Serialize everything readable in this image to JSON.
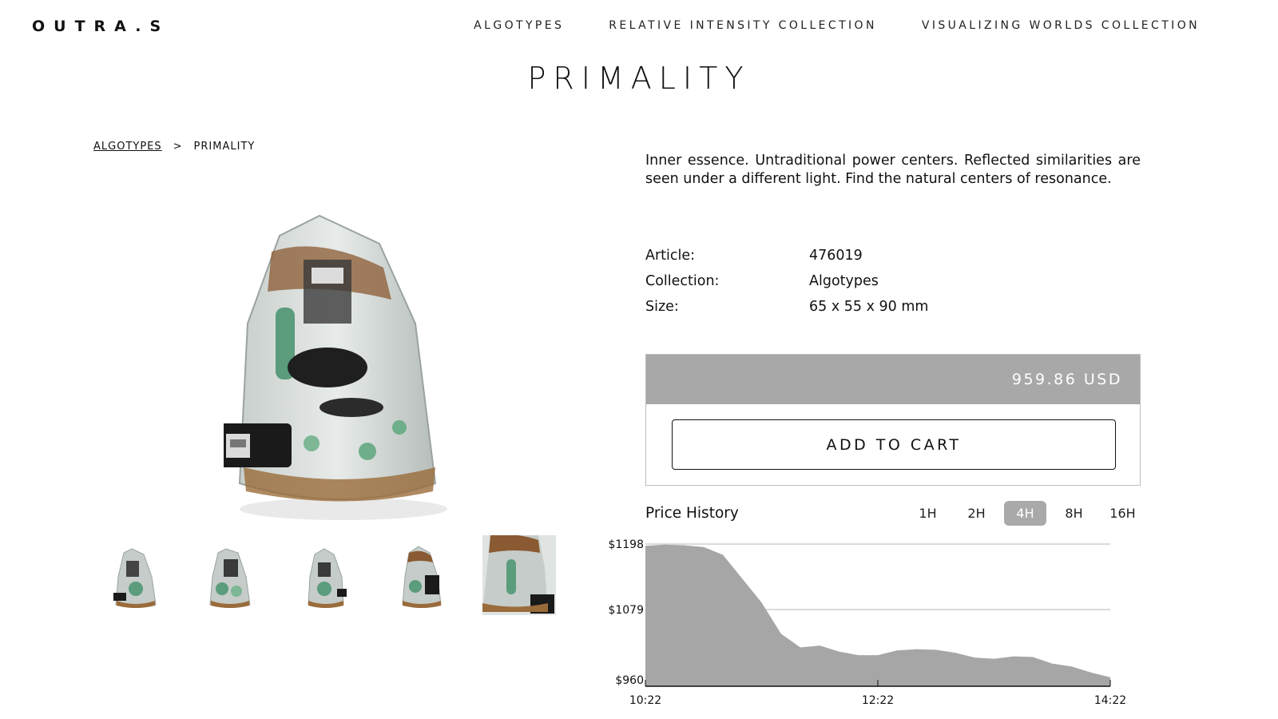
{
  "brand": "OUTRA.S",
  "nav": [
    "ALGOTYPES",
    "RELATIVE INTENSITY COLLECTION",
    "VISUALIZING WORLDS COLLECTION"
  ],
  "page_title": "PRIMALITY",
  "breadcrumb": {
    "parent": "ALGOTYPES",
    "separator": ">",
    "current": "PRIMALITY"
  },
  "product": {
    "description": "Inner essence. Untraditional power centers. Reflected similarities are seen under a different light. Find the natural centers of resonance.",
    "specs": [
      {
        "label": "Article:",
        "value": "476019"
      },
      {
        "label": "Collection:",
        "value": "Algotypes"
      },
      {
        "label": "Size:",
        "value": "65 x 55 x 90 mm"
      }
    ],
    "price": "959.86 USD",
    "add_to_cart": "ADD TO CART"
  },
  "price_history": {
    "title": "Price History",
    "ranges": [
      "1H",
      "2H",
      "4H",
      "8H",
      "16H"
    ],
    "active_range": "4H"
  },
  "colors": {
    "price_bar": "#a8a8a8",
    "chart_fill": "#a6a6a6",
    "active_range": "#a9a9a9"
  },
  "chart_data": {
    "type": "area",
    "title": "Price History",
    "y_ticks": [
      "$1198",
      "$1079",
      "$960"
    ],
    "x_ticks": [
      "10:22",
      "12:22",
      "14:22"
    ],
    "ylim": [
      960,
      1198
    ],
    "x": [
      "10:22",
      "10:32",
      "10:42",
      "10:52",
      "11:02",
      "11:12",
      "11:22",
      "11:32",
      "11:42",
      "11:52",
      "12:02",
      "12:12",
      "12:22",
      "12:32",
      "12:42",
      "12:52",
      "13:02",
      "13:12",
      "13:22",
      "13:32",
      "13:42",
      "13:52",
      "14:02",
      "14:12",
      "14:22"
    ],
    "values": [
      1195,
      1197,
      1196,
      1193,
      1180,
      1140,
      1100,
      1048,
      1025,
      1028,
      1018,
      1012,
      1012,
      1020,
      1022,
      1021,
      1016,
      1008,
      1006,
      1010,
      1009,
      998,
      993,
      983,
      975
    ]
  }
}
